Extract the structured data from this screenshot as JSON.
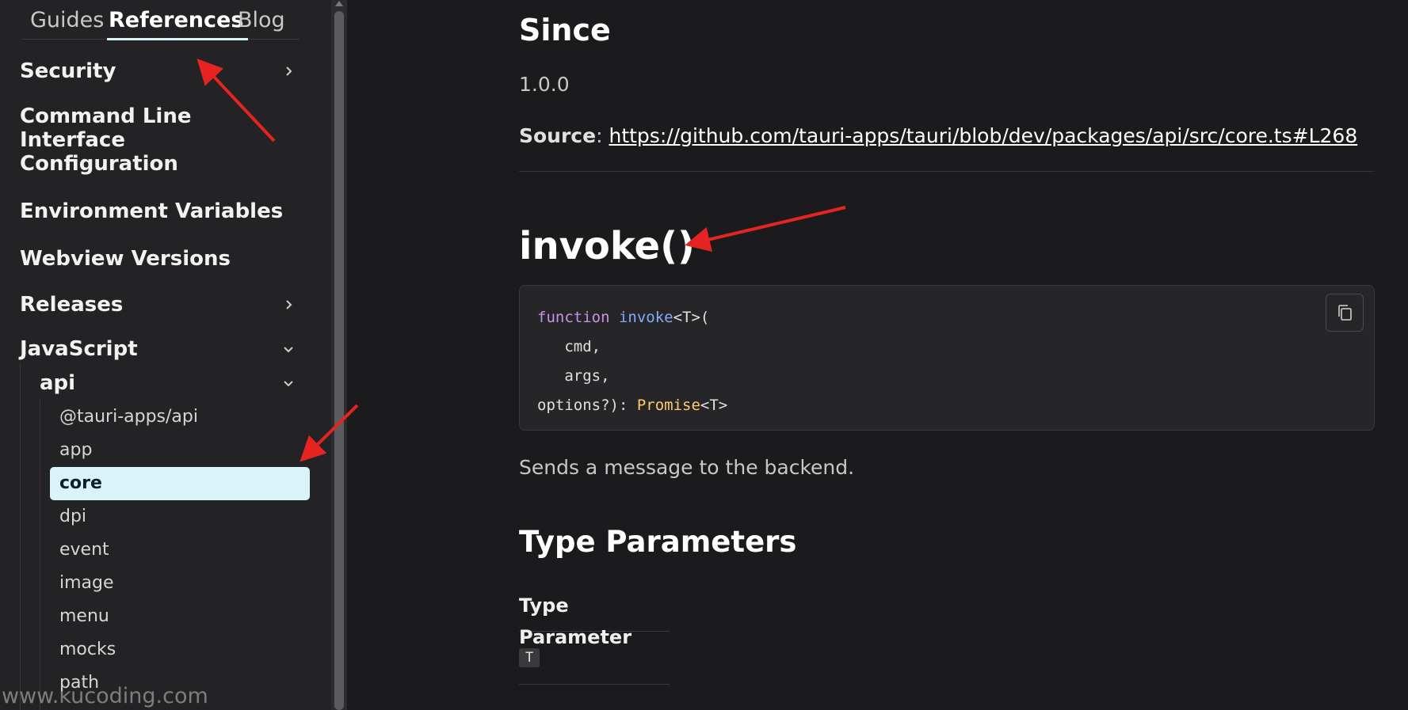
{
  "sidebar": {
    "tabs": [
      {
        "label": "Guides"
      },
      {
        "label": "References"
      },
      {
        "label": "Blog"
      }
    ],
    "items": [
      {
        "label": "Security",
        "has_chevron": true,
        "expanded": false
      },
      {
        "label": "Command Line Interface"
      },
      {
        "label": "Configuration"
      },
      {
        "label": "Environment Variables"
      },
      {
        "label": "Webview Versions"
      },
      {
        "label": "Releases",
        "has_chevron": true,
        "expanded": false
      },
      {
        "label": "JavaScript",
        "has_chevron": true,
        "expanded": true
      }
    ],
    "api_group": {
      "label": "api",
      "expanded": true
    },
    "api_items": [
      {
        "label": "@tauri-apps/api"
      },
      {
        "label": "app"
      },
      {
        "label": "core",
        "active": true
      },
      {
        "label": "dpi"
      },
      {
        "label": "event"
      },
      {
        "label": "image"
      },
      {
        "label": "menu"
      },
      {
        "label": "mocks"
      },
      {
        "label": "path"
      }
    ]
  },
  "main": {
    "since_heading": "Since",
    "since_value": "1.0.0",
    "source_label": "Source",
    "source_sep": ":",
    "source_url": "https://github.com/tauri-apps/tauri/blob/dev/packages/api/src/core.ts#L268",
    "invoke_heading": "invoke()",
    "code": {
      "keyword": "function",
      "name": "invoke",
      "generic": "<T>(",
      "param1": "cmd,",
      "param2": "args,",
      "param3": "options?): ",
      "return_type": "Promise",
      "return_generic": "<T>"
    },
    "description": "Sends a message to the backend.",
    "type_params_heading": "Type Parameters",
    "type_param_column": "Type Parameter",
    "type_param_values": [
      "T"
    ]
  },
  "watermark": "www.kucoding.com",
  "colors": {
    "background": "#1b1b1d",
    "sidebar": "#232325",
    "accent": "#d8f4f8",
    "annotation_arrow": "#e52421"
  }
}
